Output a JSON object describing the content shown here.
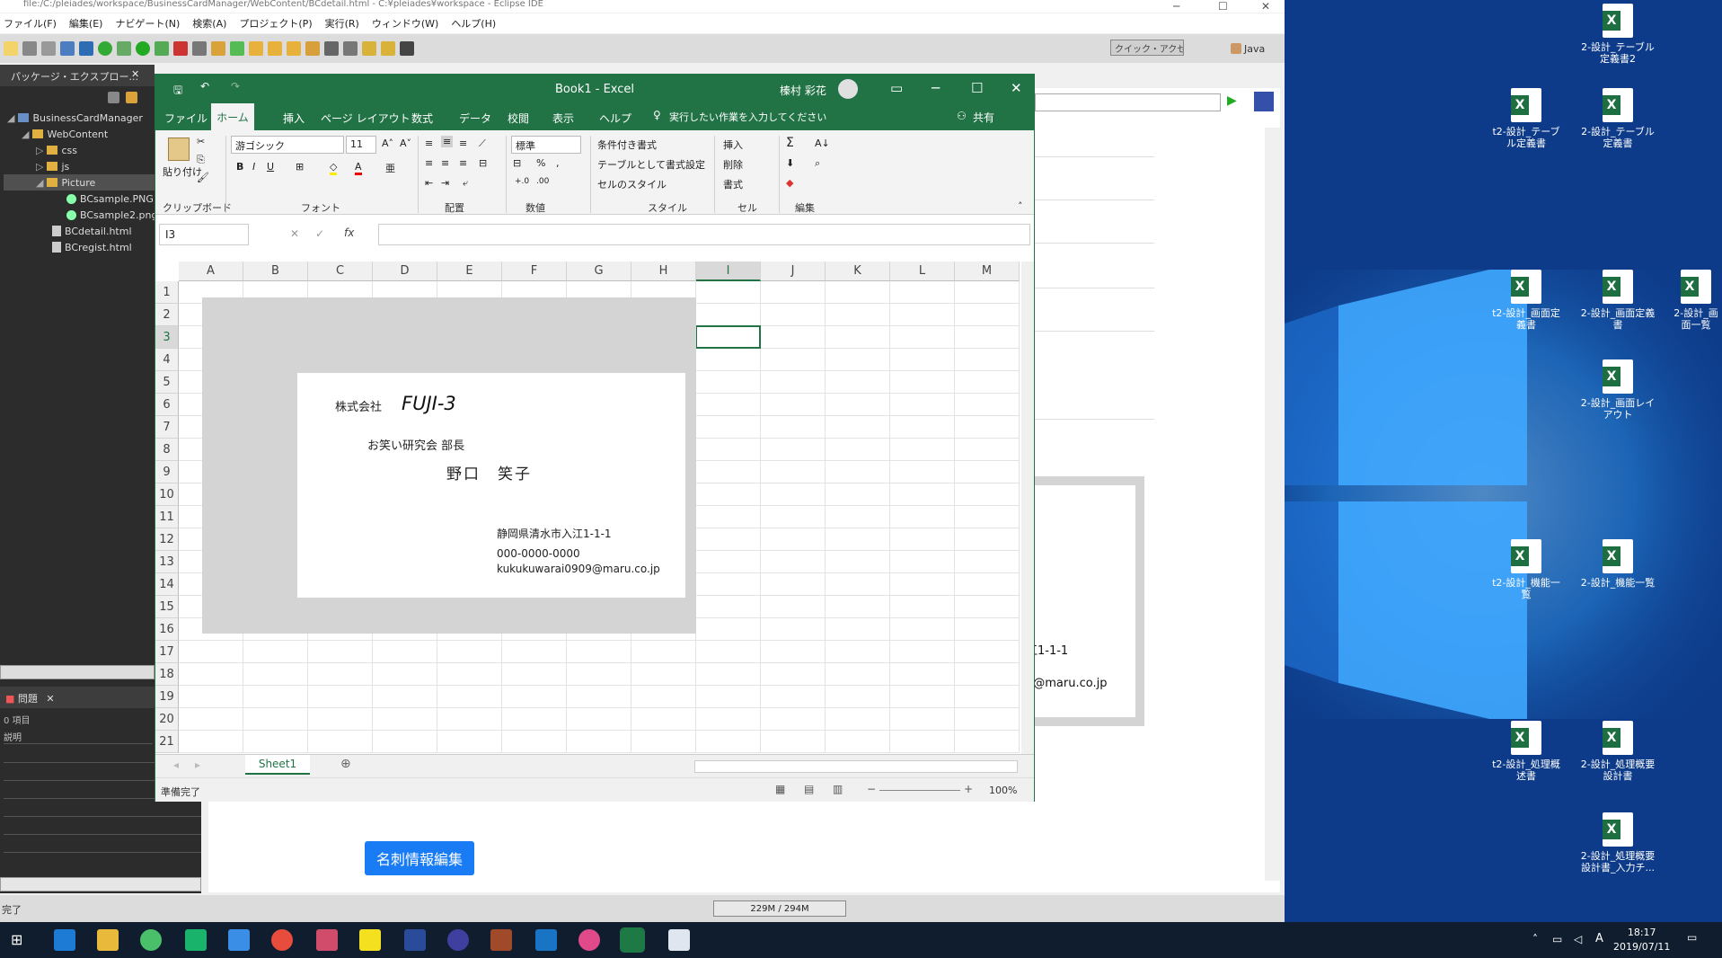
{
  "eclipse": {
    "title": "file:/C:/pleiades/workspace/BusinessCardManager/WebContent/BCdetail.html - C:¥pleiades¥workspace - Eclipse IDE",
    "menu": [
      "ファイル(F)",
      "編集(E)",
      "ナビゲート(N)",
      "検索(A)",
      "プロジェクト(P)",
      "実行(R)",
      "ウィンドウ(W)",
      "ヘルプ(H)"
    ],
    "quick_access": "クイック・アクセス",
    "perspective": "Java",
    "left_tab": "パッケージ・エクスプロー...",
    "tree": [
      "BusinessCardManager",
      "WebContent",
      "css",
      "js",
      "Picture",
      "BCsample.PNG",
      "BCsample2.png",
      "BCdetail.html",
      "BCregist.html"
    ],
    "problems_tab": "問題",
    "problems_count": "0 項目",
    "problems_col": "説明",
    "preview_address": "江1-1-1",
    "preview_mail": "9@maru.co.jp",
    "edit_button": "名刺情報編集",
    "status": "完了",
    "heap": "229M / 294M"
  },
  "excel": {
    "doc_title": "Book1  -  Excel",
    "user": "榛村 彩花",
    "share": "共有",
    "tell_me": "実行したい作業を入力してください",
    "tabs": [
      "ファイル",
      "ホーム",
      "挿入",
      "ページ レイアウト",
      "数式",
      "データ",
      "校閲",
      "表示",
      "ヘルプ"
    ],
    "ribbon": {
      "clipboard": "クリップボード",
      "paste": "貼り付け",
      "font_group": "フォント",
      "font_name": "游ゴシック",
      "font_size": "11",
      "align_group": "配置",
      "number_group": "数値",
      "number_format": "標準",
      "style_group": "スタイル",
      "cond_format": "条件付き書式",
      "table_format": "テーブルとして書式設定",
      "cell_style": "セルのスタイル",
      "cells_group": "セル",
      "insert": "挿入",
      "delete": "削除",
      "format": "書式",
      "edit_group": "編集"
    },
    "name_box": "I3",
    "fx": "fx",
    "columns": [
      "A",
      "B",
      "C",
      "D",
      "E",
      "F",
      "G",
      "H",
      "I",
      "J",
      "K",
      "L",
      "M"
    ],
    "rows": [
      "1",
      "2",
      "3",
      "4",
      "5",
      "6",
      "7",
      "8",
      "9",
      "10",
      "11",
      "12",
      "13",
      "14",
      "15",
      "16",
      "17",
      "18",
      "19",
      "20",
      "21"
    ],
    "card": {
      "company_prefix": "株式会社",
      "company_logo": "FUJI-3",
      "department": "お笑い研究会 部長",
      "name": "野口　笑子",
      "address": "静岡県清水市入江1-1-1",
      "phone": "000-0000-0000",
      "email": "kukukuwarai0909@maru.co.jp"
    },
    "sheet_tab": "Sheet1",
    "status": "準備完了",
    "zoom": "100%"
  },
  "desktop": {
    "icons": [
      "2-設計_テーブル定義書2",
      "t2-設計_テーブル定義書",
      "2-設計_テーブル定義書",
      "t2-設計_画面定義書",
      "2-設計_画面定義書",
      "2-設計_画面一覧",
      "2-設計_画面レイアウト",
      "t2-設計_機能一覧",
      "2-設計_機能一覧",
      "t2-設計_処理概述書",
      "2-設計_処理概要設計書",
      "2-設計_処理概要設計書_入力チ..."
    ]
  },
  "taskbar": {
    "time": "18:17",
    "date": "2019/07/11",
    "ime": "A"
  }
}
